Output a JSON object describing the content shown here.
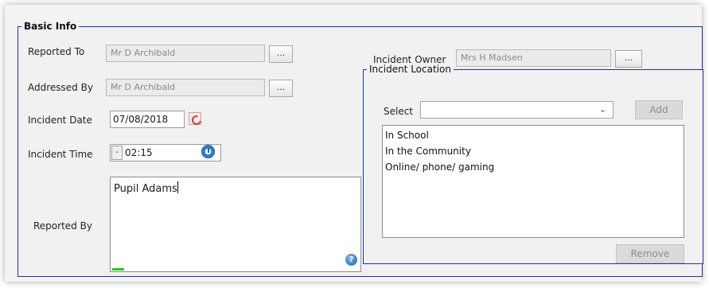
{
  "basic_info": {
    "legend": "Basic Info",
    "reported_to": {
      "label": "Reported To",
      "value": "Mr D Archibald",
      "button": "..."
    },
    "addressed_by": {
      "label": "Addressed By",
      "value": "Mr D Archibald",
      "button": "..."
    },
    "incident_date": {
      "label": "Incident Date",
      "value": "07/08/2018",
      "icon": "calendar-icon"
    },
    "incident_time": {
      "label": "Incident Time",
      "value": "02:15",
      "spin": "-",
      "icon": "clock-icon"
    },
    "reported_by": {
      "label": "Reported By",
      "value": "Pupil Adams",
      "help_icon": "?"
    },
    "incident_owner": {
      "label": "Incident Owner",
      "value": "Mrs H Madsen",
      "button": "..."
    }
  },
  "incident_location": {
    "legend": "Incident Location",
    "select_label": "Select",
    "select_value": "",
    "add_button": "Add",
    "remove_button": "Remove",
    "items": [
      "In School",
      "In the Community",
      "Online/ phone/ gaming"
    ]
  },
  "colors": {
    "accent_border": "#1f2fb0",
    "green_indicator": "#22c822"
  }
}
